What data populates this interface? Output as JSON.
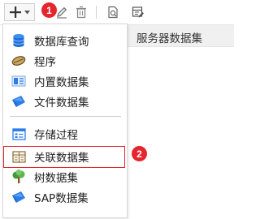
{
  "toolbar": {
    "badge1": "1",
    "badge2": "2"
  },
  "right_panel": {
    "header": "服务器数据集"
  },
  "menu": {
    "items": [
      {
        "label": "数据库查询",
        "icon": "database-icon"
      },
      {
        "label": "程序",
        "icon": "program-icon"
      },
      {
        "label": "内置数据集",
        "icon": "builtin-dataset-icon"
      },
      {
        "label": "文件数据集",
        "icon": "file-dataset-icon"
      },
      {
        "label": "存储过程",
        "icon": "stored-procedure-icon"
      },
      {
        "label": "关联数据集",
        "icon": "relation-dataset-icon"
      },
      {
        "label": "树数据集",
        "icon": "tree-dataset-icon"
      },
      {
        "label": "SAP数据集",
        "icon": "sap-dataset-icon"
      }
    ]
  },
  "colors": {
    "badge": "#e5262c",
    "highlight": "#e5262c",
    "accent_blue": "#2b7de9"
  }
}
